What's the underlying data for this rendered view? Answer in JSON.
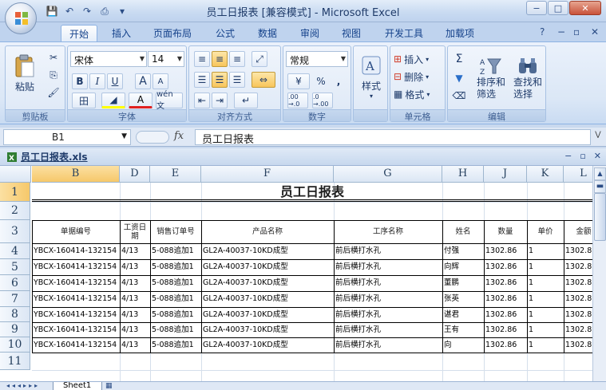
{
  "window": {
    "title": "员工日报表  [兼容模式] - Microsoft Excel",
    "controls": {
      "minimize": "−",
      "maximize": "□",
      "close": "✕"
    }
  },
  "quick_access": {
    "save": "💾",
    "undo": "↶",
    "redo": "↷",
    "preview": "⎙",
    "more": "▾"
  },
  "ribbon": {
    "tabs": [
      "开始",
      "插入",
      "页面布局",
      "公式",
      "数据",
      "审阅",
      "视图",
      "开发工具",
      "加载项"
    ],
    "active_tab": "开始",
    "help": "?",
    "win_min": "−",
    "win_restore": "▫",
    "win_close": "✕",
    "clipboard": {
      "label": "剪贴板",
      "paste": "粘贴",
      "cut": "✂",
      "copy": "⎘",
      "format_painter": "🖌"
    },
    "font": {
      "label": "字体",
      "name": "宋体",
      "size": "14",
      "grow": "A",
      "shrink": "A",
      "bold": "B",
      "italic": "I",
      "underline": "U",
      "border": "田",
      "fill": "◢",
      "color": "A",
      "wen": "wén 文"
    },
    "alignment": {
      "label": "对齐方式"
    },
    "number": {
      "label": "数字",
      "format": "常规",
      "percent": "%",
      "comma": ",",
      "inc": ".00 →.0",
      "dec": ".0 →.00"
    },
    "styles": {
      "label": "样式",
      "button": "样式"
    },
    "cells": {
      "label": "单元格",
      "insert": "插入",
      "delete": "删除",
      "format": "格式"
    },
    "editing": {
      "label": "编辑",
      "sort_filter": "排序和\n筛选",
      "find_select": "查找和\n选择",
      "sum": "Σ"
    }
  },
  "formula_bar": {
    "name_box": "B1",
    "fx": "fx",
    "content": "员工日报表"
  },
  "workbook": {
    "name": "员工日报表.xls",
    "controls": {
      "min": "−",
      "restore": "▫",
      "close": "✕"
    }
  },
  "sheet": {
    "columns": [
      "B",
      "D",
      "E",
      "F",
      "G",
      "H",
      "J",
      "K",
      "L"
    ],
    "selected_column": "B",
    "rows": [
      "1",
      "2",
      "3",
      "4",
      "5",
      "6",
      "7",
      "8",
      "9",
      "10",
      "11"
    ],
    "selected_row": "1",
    "title": "员工日报表",
    "headers": [
      "单据编号",
      "工资日\n期",
      "销售订单号",
      "产品名称",
      "工序名称",
      "姓名",
      "数量",
      "单价",
      "金额"
    ],
    "data": [
      [
        "YBCX-160414-132154",
        "4/13",
        "5-088追加1",
        "GL2A-40037-10KD成型",
        "前后横打水孔",
        "付强",
        "1302.86",
        "1",
        "1302.8"
      ],
      [
        "YBCX-160414-132154",
        "4/13",
        "5-088追加1",
        "GL2A-40037-10KD成型",
        "前后横打水孔",
        "向辉",
        "1302.86",
        "1",
        "1302.8"
      ],
      [
        "YBCX-160414-132154",
        "4/13",
        "5-088追加1",
        "GL2A-40037-10KD成型",
        "前后横打水孔",
        "董鹏",
        "1302.86",
        "1",
        "1302.8"
      ],
      [
        "YBCX-160414-132154",
        "4/13",
        "5-088追加1",
        "GL2A-40037-10KD成型",
        "前后横打水孔",
        "张英",
        "1302.86",
        "1",
        "1302.8"
      ],
      [
        "YBCX-160414-132154",
        "4/13",
        "5-088追加1",
        "GL2A-40037-10KD成型",
        "前后横打水孔",
        "谌君",
        "1302.86",
        "1",
        "1302.8"
      ],
      [
        "YBCX-160414-132154",
        "4/13",
        "5-088追加1",
        "GL2A-40037-10KD成型",
        "前后横打水孔",
        "王有",
        "1302.86",
        "1",
        "1302.8"
      ],
      [
        "YBCX-160414-132154",
        "4/13",
        "5-088追加1",
        "GL2A-40037-10KD成型",
        "前后横打水孔",
        "向",
        "1302.86",
        "1",
        "1302.8"
      ]
    ],
    "tab": "Sheet1"
  }
}
